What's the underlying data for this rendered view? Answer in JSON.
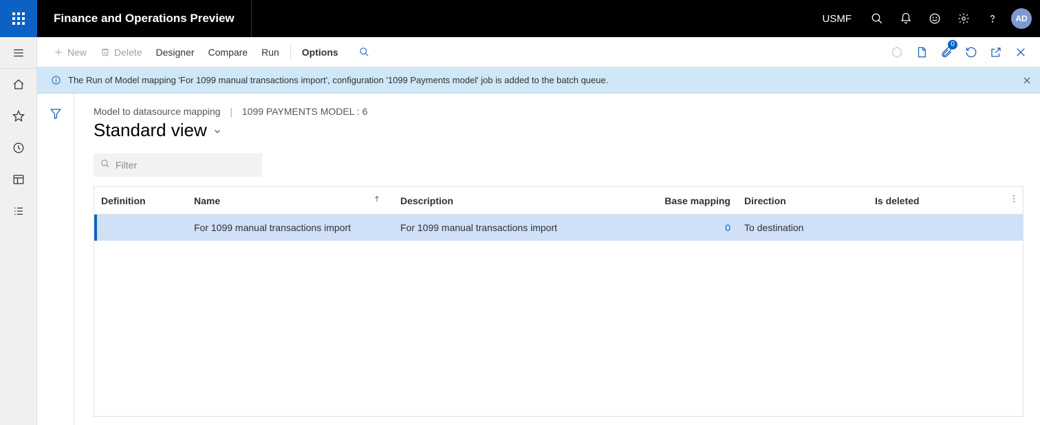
{
  "header": {
    "app_title": "Finance and Operations Preview",
    "company": "USMF",
    "avatar_initials": "AD"
  },
  "commandbar": {
    "new": "New",
    "delete": "Delete",
    "designer": "Designer",
    "compare": "Compare",
    "run": "Run",
    "options": "Options",
    "badge_count": "0"
  },
  "banner": {
    "message": "The Run of Model mapping 'For 1099 manual transactions import', configuration '1099 Payments model' job is added to the batch queue."
  },
  "breadcrumb": {
    "part1": "Model to datasource mapping",
    "part2": "1099 PAYMENTS MODEL : 6"
  },
  "view": {
    "title": "Standard view"
  },
  "filter": {
    "placeholder": "Filter"
  },
  "columns": {
    "definition": "Definition",
    "name": "Name",
    "description": "Description",
    "base_mapping": "Base mapping",
    "direction": "Direction",
    "is_deleted": "Is deleted"
  },
  "rows": [
    {
      "definition": "",
      "name": "For 1099 manual transactions import",
      "description": "For 1099 manual transactions import",
      "base_mapping": "0",
      "direction": "To destination",
      "is_deleted": ""
    }
  ]
}
